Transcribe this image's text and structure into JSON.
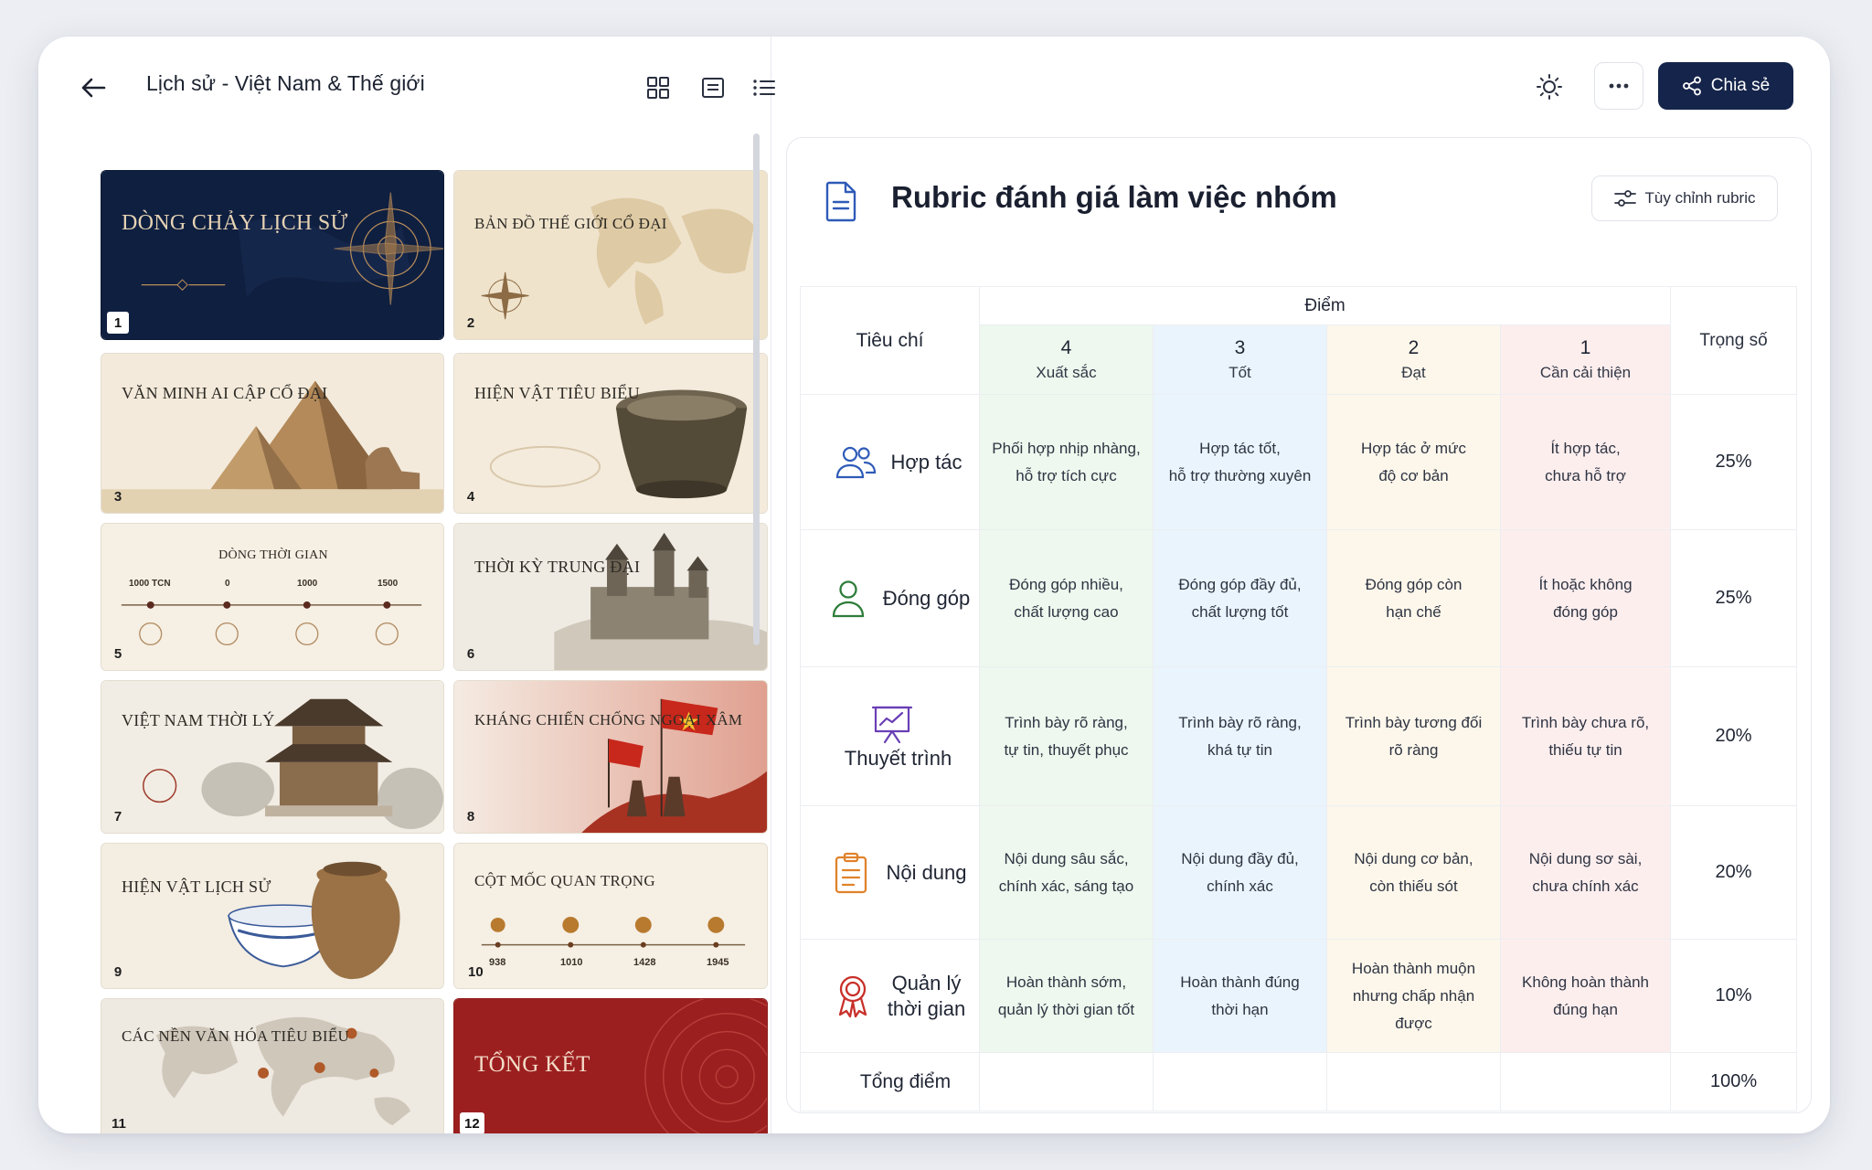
{
  "deck": {
    "title": "Lịch sử - Việt Nam & Thế giới",
    "slides": [
      {
        "number": "1",
        "title": "DÒNG CHẢY LỊCH SỬ"
      },
      {
        "number": "2",
        "title": "BẢN ĐỒ THẾ GIỚI CỔ ĐẠI"
      },
      {
        "number": "3",
        "title": "VĂN MINH AI CẬP CỔ ĐẠI"
      },
      {
        "number": "4",
        "title": "HIỆN VẬT TIÊU BIỂU"
      },
      {
        "number": "5",
        "title": "DÒNG THỜI GIAN",
        "ticks": [
          "1000 TCN",
          "0",
          "1000",
          "1500"
        ]
      },
      {
        "number": "6",
        "title": "THỜI KỲ TRUNG ĐẠI"
      },
      {
        "number": "7",
        "title": "VIỆT NAM THỜI LÝ"
      },
      {
        "number": "8",
        "title": "KHÁNG CHIẾN CHỐNG NGOẠI XÂM"
      },
      {
        "number": "9",
        "title": "HIỆN VẬT LỊCH SỬ"
      },
      {
        "number": "10",
        "title": "CỘT MỐC QUAN TRỌNG",
        "ticks": [
          "938",
          "1010",
          "1428",
          "1945"
        ]
      },
      {
        "number": "11",
        "title": "CÁC NỀN VĂN HÓA TIÊU BIỂU"
      },
      {
        "number": "12",
        "title": "TỔNG KẾT"
      }
    ]
  },
  "toolbar": {
    "share_label": "Chia sẻ",
    "icons": [
      "back-arrow-icon",
      "grid-view-icon",
      "slide-view-icon",
      "list-view-icon",
      "sun-icon",
      "more-icon",
      "share-icon"
    ]
  },
  "rubric": {
    "title": "Rubric đánh giá làm việc nhóm",
    "customize_label": "Tùy chỉnh rubric",
    "criteria_header": "Tiêu chí",
    "score_header": "Điểm",
    "weight_header": "Trọng số",
    "levels": [
      {
        "score": "4",
        "label": "Xuất sắc",
        "color": "#eef8ee"
      },
      {
        "score": "3",
        "label": "Tốt",
        "color": "#eaf4fc"
      },
      {
        "score": "2",
        "label": "Đạt",
        "color": "#fdf7eb"
      },
      {
        "score": "1",
        "label": "Cần cải thiện",
        "color": "#fdeeee"
      }
    ],
    "rows": [
      {
        "criterion": "Hợp tác",
        "icon": "people-icon",
        "d4": [
          "Phối hợp nhịp nhàng,",
          "hỗ trợ tích cực"
        ],
        "d3": [
          "Hợp tác tốt,",
          "hỗ trợ thường xuyên"
        ],
        "d2": [
          "Hợp tác ở mức",
          "độ cơ bản"
        ],
        "d1": [
          "Ít hợp tác,",
          "chưa hỗ trợ"
        ],
        "weight": "25%"
      },
      {
        "criterion": "Đóng góp",
        "icon": "person-icon",
        "d4": [
          "Đóng góp nhiều,",
          "chất lượng cao"
        ],
        "d3": [
          "Đóng góp đầy đủ,",
          "chất lượng tốt"
        ],
        "d2": [
          "Đóng góp còn",
          "hạn chế"
        ],
        "d1": [
          "Ít hoặc không",
          "đóng góp"
        ],
        "weight": "25%"
      },
      {
        "criterion": "Thuyết trình",
        "icon": "presentation-icon",
        "d4": [
          "Trình bày rõ ràng,",
          "tự tin, thuyết phục"
        ],
        "d3": [
          "Trình bày rõ ràng,",
          "khá tự tin"
        ],
        "d2": [
          "Trình bày tương đối",
          "rõ ràng"
        ],
        "d1": [
          "Trình bày chưa rõ,",
          "thiếu tự tin"
        ],
        "weight": "20%"
      },
      {
        "criterion": "Nội dung",
        "icon": "clipboard-icon",
        "d4": [
          "Nội dung sâu sắc,",
          "chính xác, sáng tạo"
        ],
        "d3": [
          "Nội dung đầy đủ,",
          "chính xác"
        ],
        "d2": [
          "Nội dung cơ bản,",
          "còn thiếu sót"
        ],
        "d1": [
          "Nội dung sơ sài,",
          "chưa chính xác"
        ],
        "weight": "20%"
      },
      {
        "criterion": [
          "Quản lý",
          "thời gian"
        ],
        "icon": "award-ribbon-icon",
        "d4": [
          "Hoàn thành sớm,",
          "quản lý thời gian tốt"
        ],
        "d3": [
          "Hoàn thành đúng",
          "thời hạn"
        ],
        "d2": [
          "Hoàn thành muộn",
          "nhưng chấp nhận được"
        ],
        "d1": [
          "Không hoàn thành",
          "đúng hạn"
        ],
        "weight": "10%"
      }
    ],
    "total_label": "Tổng điểm",
    "total_weight": "100%"
  }
}
